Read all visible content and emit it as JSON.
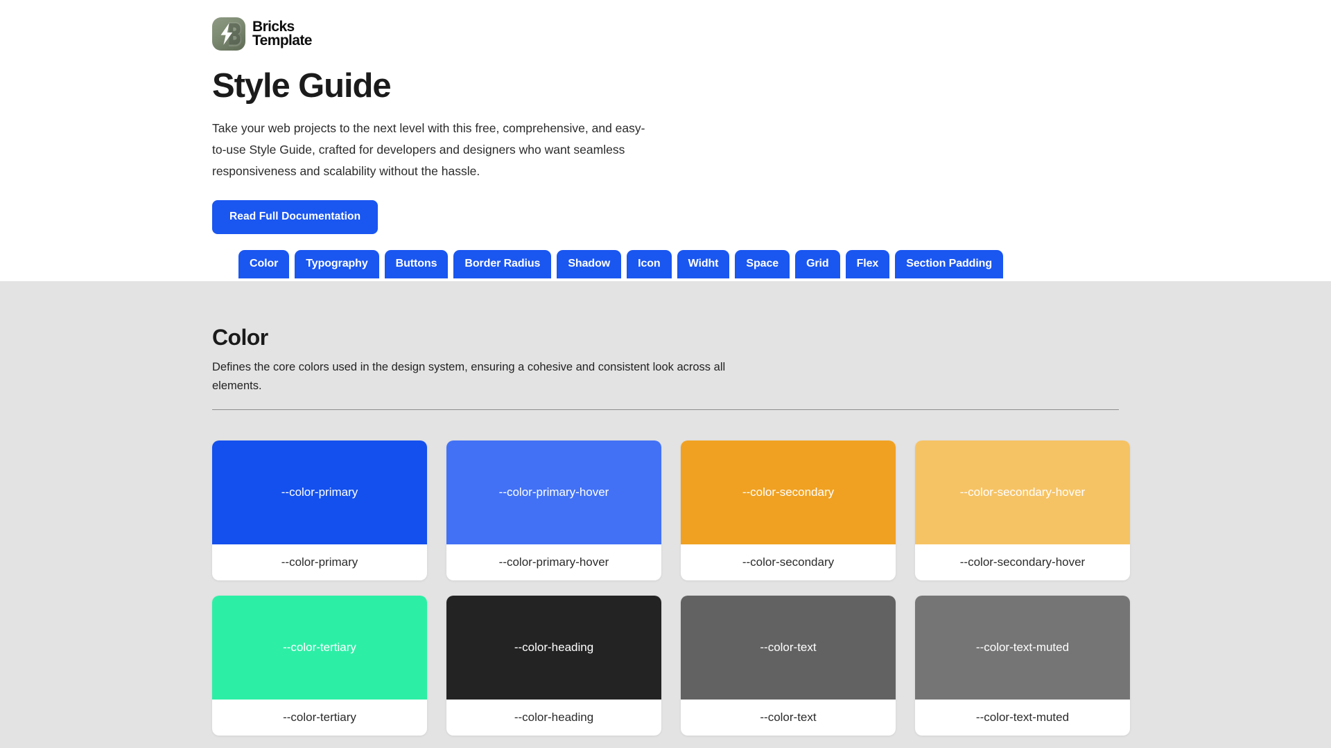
{
  "brand": {
    "logo_icon": "bricks-lightning-logo-icon",
    "logo_text": "Bricks\nTemplate"
  },
  "hero": {
    "title": "Style Guide",
    "description": "Take your web projects to the next level with this free, comprehensive, and easy-to-use Style Guide, crafted for developers and designers who want seamless responsiveness and scalability without the hassle.",
    "cta_label": "Read Full Documentation",
    "cta_color": "#1a56f0"
  },
  "tabs": [
    {
      "label": "Color"
    },
    {
      "label": "Typography"
    },
    {
      "label": "Buttons"
    },
    {
      "label": "Border Radius"
    },
    {
      "label": "Shadow"
    },
    {
      "label": "Icon"
    },
    {
      "label": "Widht"
    },
    {
      "label": "Space"
    },
    {
      "label": "Grid"
    },
    {
      "label": "Flex"
    },
    {
      "label": "Section Padding"
    }
  ],
  "color_section": {
    "title": "Color",
    "description": "Defines the core colors used in the design system, ensuring a cohesive and consistent look across all elements.",
    "background": "#e3e3e3",
    "swatches": [
      {
        "chip_label": "--color-primary",
        "caption": "--color-primary",
        "hex": "#1350ED",
        "chip_text_color": "#ffffff"
      },
      {
        "chip_label": "--color-primary-hover",
        "caption": "--color-primary-hover",
        "hex": "#4271F5",
        "chip_text_color": "#ffffff"
      },
      {
        "chip_label": "--color-secondary",
        "caption": "--color-secondary",
        "hex": "#F0A122",
        "chip_text_color": "#ffffff"
      },
      {
        "chip_label": "--color-secondary-hover",
        "caption": "--color-secondary-hover",
        "hex": "#F6C364",
        "chip_text_color": "#ffffff"
      },
      {
        "chip_label": "--color-tertiary",
        "caption": "--color-tertiary",
        "hex": "#2CEFA5",
        "chip_text_color": "#ffffff"
      },
      {
        "chip_label": "--color-heading",
        "caption": "--color-heading",
        "hex": "#232323",
        "chip_text_color": "#ffffff"
      },
      {
        "chip_label": "--color-text",
        "caption": "--color-text",
        "hex": "#626262",
        "chip_text_color": "#ffffff"
      },
      {
        "chip_label": "--color-text-muted",
        "caption": "--color-text-muted",
        "hex": "#757575",
        "chip_text_color": "#ffffff"
      }
    ]
  }
}
